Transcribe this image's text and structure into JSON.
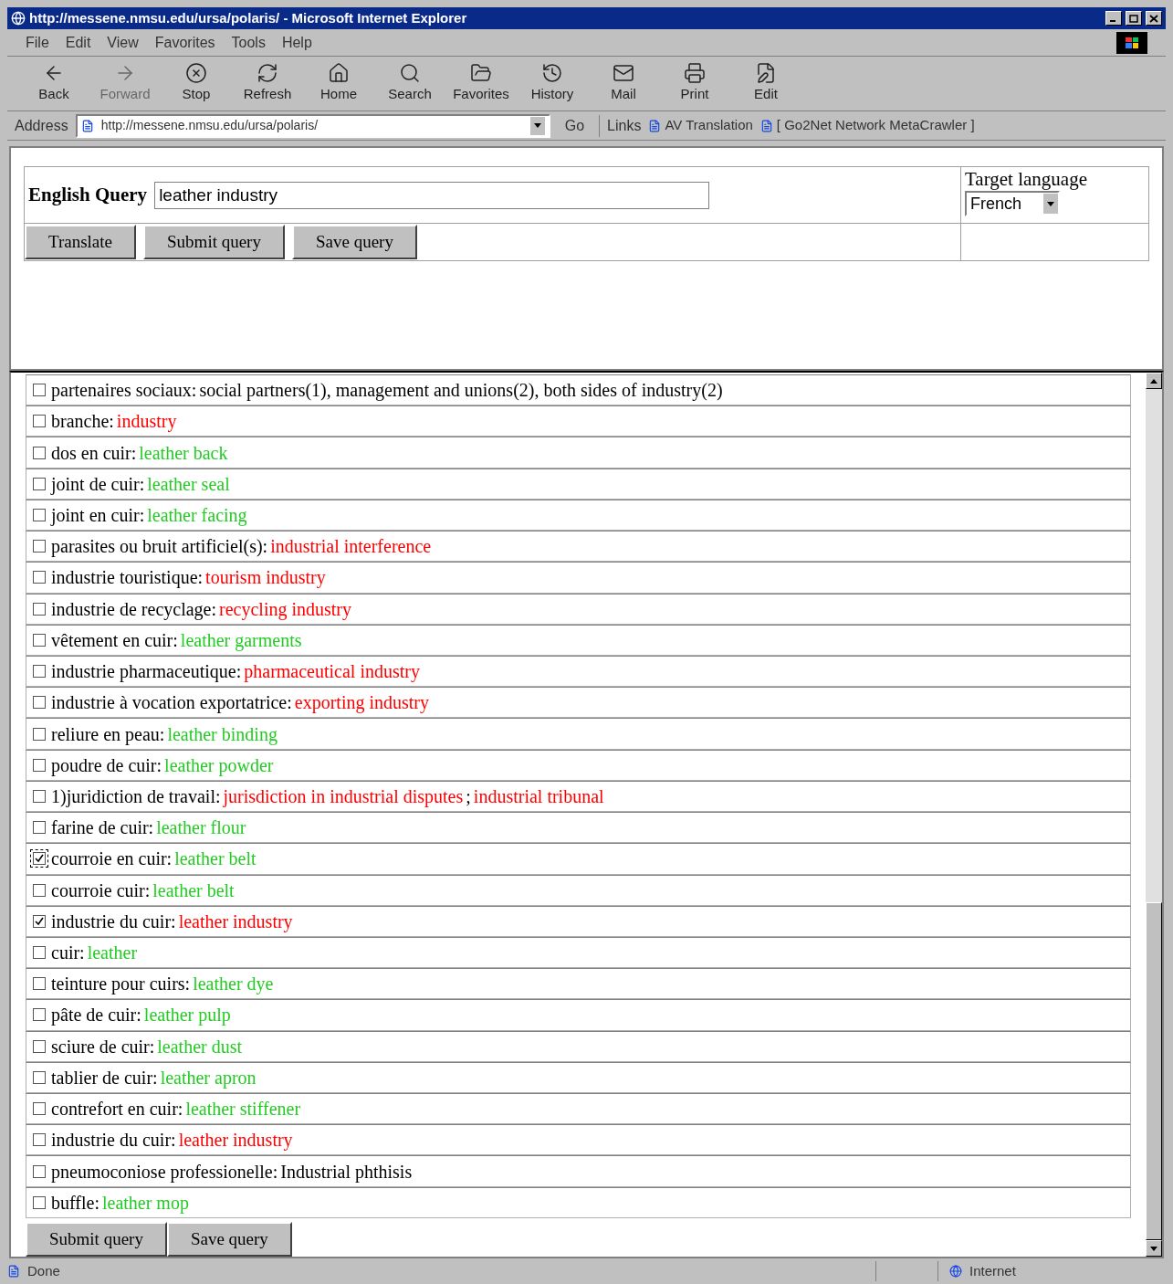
{
  "window": {
    "title": "http://messene.nmsu.edu/ursa/polaris/ - Microsoft Internet Explorer"
  },
  "menu": [
    "File",
    "Edit",
    "View",
    "Favorites",
    "Tools",
    "Help"
  ],
  "toolbar": [
    {
      "label": "Back",
      "kind": "back",
      "disabled": false
    },
    {
      "label": "Forward",
      "kind": "forward",
      "disabled": true
    },
    {
      "label": "Stop",
      "kind": "stop",
      "disabled": false
    },
    {
      "label": "Refresh",
      "kind": "refresh",
      "disabled": false
    },
    {
      "label": "Home",
      "kind": "home",
      "disabled": false
    },
    {
      "label": "Search",
      "kind": "search",
      "disabled": false
    },
    {
      "label": "Favorites",
      "kind": "favorites",
      "disabled": false
    },
    {
      "label": "History",
      "kind": "history",
      "disabled": false
    },
    {
      "label": "Mail",
      "kind": "mail",
      "disabled": false
    },
    {
      "label": "Print",
      "kind": "print",
      "disabled": false
    },
    {
      "label": "Edit",
      "kind": "edit",
      "disabled": false
    }
  ],
  "address_bar": {
    "label": "Address",
    "url": "http://messene.nmsu.edu/ursa/polaris/",
    "go": "Go",
    "links_label": "Links",
    "links": [
      "AV Translation",
      "[ Go2Net Network MetaCrawler ]"
    ]
  },
  "query_form": {
    "label": "English Query",
    "value": "leather industry",
    "buttons": [
      "Translate",
      "Submit query",
      "Save query"
    ],
    "target_label": "Target language",
    "target_value": "French"
  },
  "results": [
    {
      "term": "partenaires sociaux:",
      "checked": false,
      "focused": false,
      "parts": [
        {
          "text": "social partners(1), management and unions(2), both sides of industry(2)",
          "color": "#000000"
        }
      ]
    },
    {
      "term": "branche:",
      "checked": false,
      "focused": false,
      "parts": [
        {
          "text": "industry",
          "color": "#ff0000"
        }
      ]
    },
    {
      "term": "dos en cuir:",
      "checked": false,
      "focused": false,
      "parts": [
        {
          "text": "leather back",
          "color": "#22cc22"
        }
      ]
    },
    {
      "term": "joint de cuir:",
      "checked": false,
      "focused": false,
      "parts": [
        {
          "text": "leather seal",
          "color": "#22cc22"
        }
      ]
    },
    {
      "term": "joint en cuir:",
      "checked": false,
      "focused": false,
      "parts": [
        {
          "text": "leather facing",
          "color": "#22cc22"
        }
      ]
    },
    {
      "term": "parasites ou bruit artificiel(s):",
      "checked": false,
      "focused": false,
      "parts": [
        {
          "text": "industrial interference",
          "color": "#ff0000"
        }
      ]
    },
    {
      "term": "industrie touristique:",
      "checked": false,
      "focused": false,
      "parts": [
        {
          "text": "tourism industry",
          "color": "#ff0000"
        }
      ]
    },
    {
      "term": "industrie de recyclage:",
      "checked": false,
      "focused": false,
      "parts": [
        {
          "text": "recycling industry",
          "color": "#ff0000"
        }
      ]
    },
    {
      "term": "vêtement en cuir:",
      "checked": false,
      "focused": false,
      "parts": [
        {
          "text": "leather garments",
          "color": "#22cc22"
        }
      ]
    },
    {
      "term": "industrie pharmaceutique:",
      "checked": false,
      "focused": false,
      "parts": [
        {
          "text": "pharmaceutical industry",
          "color": "#ff0000"
        }
      ]
    },
    {
      "term": "industrie à vocation exportatrice:",
      "checked": false,
      "focused": false,
      "parts": [
        {
          "text": "exporting industry",
          "color": "#ff0000"
        }
      ]
    },
    {
      "term": "reliure en peau:",
      "checked": false,
      "focused": false,
      "parts": [
        {
          "text": "leather binding",
          "color": "#22cc22"
        }
      ]
    },
    {
      "term": "poudre de cuir:",
      "checked": false,
      "focused": false,
      "parts": [
        {
          "text": "leather powder",
          "color": "#22cc22"
        }
      ]
    },
    {
      "term": "1)juridiction de travail:",
      "checked": false,
      "focused": false,
      "parts": [
        {
          "text": "jurisdiction in industrial disputes",
          "color": "#ff0000"
        },
        {
          "text": ";",
          "color": "#000000"
        },
        {
          "text": "industrial tribunal",
          "color": "#ff0000"
        }
      ]
    },
    {
      "term": "farine de cuir:",
      "checked": false,
      "focused": false,
      "parts": [
        {
          "text": "leather flour",
          "color": "#22cc22"
        }
      ]
    },
    {
      "term": "courroie en cuir:",
      "checked": true,
      "focused": true,
      "parts": [
        {
          "text": "leather belt",
          "color": "#22cc22"
        }
      ]
    },
    {
      "term": "courroie cuir:",
      "checked": false,
      "focused": false,
      "parts": [
        {
          "text": "leather belt",
          "color": "#22cc22"
        }
      ]
    },
    {
      "term": "industrie du cuir:",
      "checked": true,
      "focused": false,
      "parts": [
        {
          "text": "leather industry",
          "color": "#ff0000"
        }
      ]
    },
    {
      "term": "cuir:",
      "checked": false,
      "focused": false,
      "parts": [
        {
          "text": "leather",
          "color": "#22cc22"
        }
      ]
    },
    {
      "term": "teinture pour cuirs:",
      "checked": false,
      "focused": false,
      "parts": [
        {
          "text": "leather dye",
          "color": "#22cc22"
        }
      ]
    },
    {
      "term": "pâte de cuir:",
      "checked": false,
      "focused": false,
      "parts": [
        {
          "text": "leather pulp",
          "color": "#22cc22"
        }
      ]
    },
    {
      "term": "sciure de cuir:",
      "checked": false,
      "focused": false,
      "parts": [
        {
          "text": "leather dust",
          "color": "#22cc22"
        }
      ]
    },
    {
      "term": "tablier de cuir:",
      "checked": false,
      "focused": false,
      "parts": [
        {
          "text": "leather apron",
          "color": "#22cc22"
        }
      ]
    },
    {
      "term": "contrefort en cuir:",
      "checked": false,
      "focused": false,
      "parts": [
        {
          "text": "leather stiffener",
          "color": "#22cc22"
        }
      ]
    },
    {
      "term": "industrie du cuir:",
      "checked": false,
      "focused": false,
      "parts": [
        {
          "text": "leather industry",
          "color": "#ff0000"
        }
      ]
    },
    {
      "term": "pneumoconiose professionelle:",
      "checked": false,
      "focused": false,
      "parts": [
        {
          "text": "Industrial phthisis",
          "color": "#000000"
        }
      ]
    },
    {
      "term": "buffle:",
      "checked": false,
      "focused": false,
      "parts": [
        {
          "text": "leather mop",
          "color": "#22cc22"
        }
      ]
    }
  ],
  "result_buttons": [
    "Submit query",
    "Save query"
  ],
  "status_bar": {
    "text": "Done",
    "zone": "Internet"
  }
}
